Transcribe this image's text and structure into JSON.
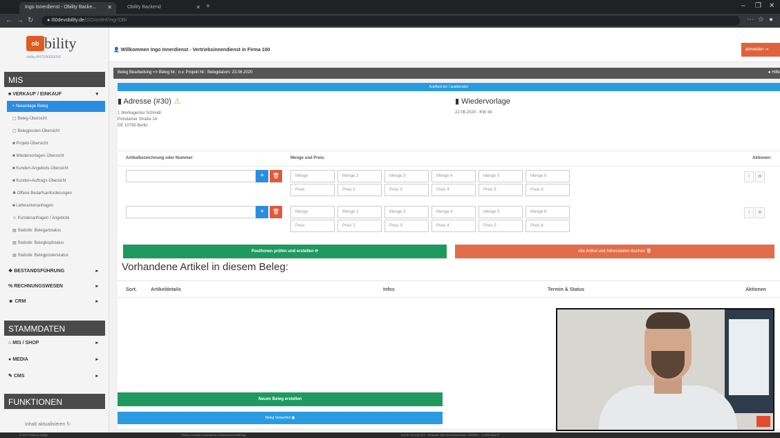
{
  "browser": {
    "tabs": [
      {
        "label": "Ingo Innerdienst - Obility Backe...",
        "active": true
      },
      {
        "label": "Obility Backend",
        "active": false
      }
    ],
    "url_host": "i50devobility.de",
    "url_path": "/iSO/orderl/mgr/OB/"
  },
  "sidebar": {
    "logo_text": "bility",
    "logo_mark": "ob",
    "logo_sub": "obility ANTONIERENS",
    "sections": {
      "mis": "MIS",
      "stammdaten": "STAMMDATEN",
      "funktionen": "FUNKTIONEN"
    },
    "groups": {
      "verkauf": "VERKAUF / EINKAUF",
      "bestand": "BESTANDSFÜHRUNG",
      "rechnung": "RECHNUNGSWESEN",
      "crm": "CRM",
      "mis_shop": "MIS / SHOP",
      "media": "MEDIA",
      "cms": "CMS"
    },
    "items": [
      "Neuanlage Beleg",
      "Beleg-Übersicht",
      "Belegposten-Übersicht",
      "Projekt-Übersicht",
      "Wiedervorlagen-Übersicht",
      "Kunden-Angebots-Übersicht",
      "Kunden-Auftrags-Übersicht",
      "Offene Bedarfsanforderungen",
      "Lieferantenanfragen",
      "Kundenanfragen / Angebote",
      "Statistik: Belegartstatus",
      "Statistik: Belegkopfstatus",
      "Statistik: Belegpostenstatus"
    ],
    "collapse_label": "Inhalt aktualisieren"
  },
  "header": {
    "welcome": "Willkommen Ingo Innerdienst - Vertriebsinnendienst in Firma 100",
    "logout": "abmelden"
  },
  "main": {
    "title": "Beleg Bearbeitung => Beleg Nr.: n.v. Projekt Nr.: Belegdatum: 23.06.2020",
    "help": "Hilfe",
    "info_bar": "Kopftext ein / ausblenden",
    "address": {
      "heading": "Adresse (#30)",
      "lines": [
        "1 Werbagentur Schmidt",
        "Potsdamer Straße 14",
        "DE 10785 Berlin"
      ]
    },
    "wiedervorlage": {
      "heading": "Wiedervorlage",
      "value": "22.08.2020 - KW 34"
    },
    "table_headers": {
      "artikel": "Artikelbezeichnung oder Nummer:",
      "menge_preis": "Menge und Preis:",
      "aktionen": "Aktionen:"
    },
    "menge_labels": [
      "Menge",
      "Menge 2",
      "Menge 3",
      "Menge 4",
      "Menge 5",
      "Menge 6"
    ],
    "preis_labels": [
      "Preis",
      "Preis 2",
      "Preis 3",
      "Preis 4",
      "Preis 5",
      "Preis 6"
    ],
    "btn_pruefen": "Positionen prüfen und erstellen",
    "btn_loeschen": "Alle Artikel und Adressdaten löschen",
    "vorhandene": "Vorhandene Artikel in diesem Beleg:",
    "columns": [
      "Sort.",
      "Artikeldetails",
      "Infos",
      "Termin & Status",
      "Aktionen"
    ],
    "btn_neuer_beleg": "Neuen Beleg erstellen",
    "btn_beleg_verwerfen": "Beleg Verwerfen"
  },
  "footer": {
    "copyright": "© 2007-2020 by Obility",
    "links": "Obility | Kontakt | Impressum | Datenschutzerklärung",
    "info": "Ihre IP: 24.134.43.1 · Releaser: 850 Versionsnummer: 2020001 · 1.0042 Build 8"
  },
  "colors": {
    "accent_blue": "#2a8de0",
    "green": "#1e9960",
    "orange": "#e26d4b",
    "dark_header": "#4a4a4a"
  }
}
